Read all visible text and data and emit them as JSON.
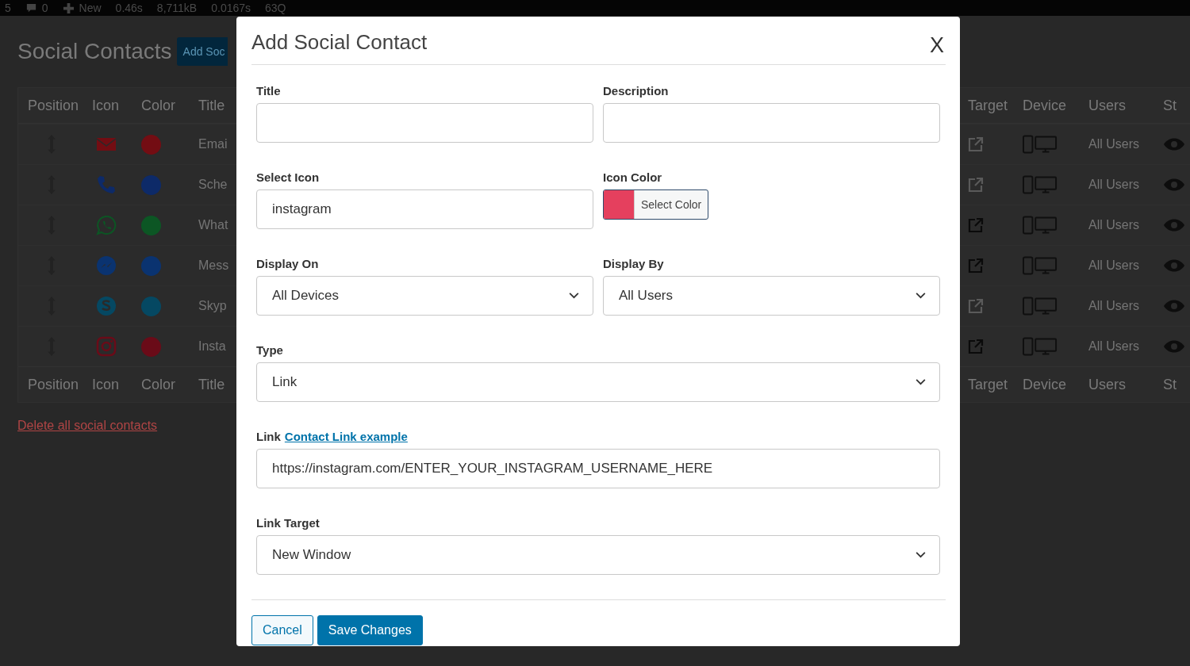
{
  "admin_bar": {
    "items": [
      {
        "kind": "text",
        "label": "5"
      },
      {
        "kind": "comments",
        "label": "0"
      },
      {
        "kind": "new",
        "label": "New"
      },
      {
        "kind": "text",
        "label": "0.46s"
      },
      {
        "kind": "text",
        "label": "8,711kB"
      },
      {
        "kind": "text",
        "label": "0.0167s"
      },
      {
        "kind": "text",
        "label": "63Q"
      }
    ]
  },
  "page": {
    "title": "Social Contacts",
    "add_button": "Add Soc"
  },
  "table": {
    "columns_left": [
      "Position",
      "Icon",
      "Color",
      "Title"
    ],
    "columns_right": [
      "Target",
      "Device",
      "Users",
      "St"
    ],
    "rows": [
      {
        "kind": "email",
        "color": "#730d13",
        "title": "Emai",
        "new_window": false,
        "users": "All Users"
      },
      {
        "kind": "phone",
        "color": "#0d2a68",
        "title": "Sche",
        "new_window": false,
        "users": "All Users"
      },
      {
        "kind": "whatsapp",
        "color": "#0c5624",
        "title": "What",
        "new_window": true,
        "users": "All Users"
      },
      {
        "kind": "messenger",
        "color": "#0a3370",
        "title": "Mess",
        "new_window": true,
        "users": "All Users"
      },
      {
        "kind": "skype",
        "color": "#054862",
        "title": "Skyp",
        "new_window": false,
        "users": "All Users"
      },
      {
        "kind": "instagram",
        "color": "#6a0b18",
        "title": "Insta",
        "new_window": true,
        "users": "All Users"
      }
    ],
    "footer_left": [
      "Position",
      "Icon",
      "Color",
      "Title"
    ],
    "footer_right": [
      "Target",
      "Device",
      "Users",
      "St"
    ]
  },
  "delete_link": "Delete all social contacts",
  "modal": {
    "title": "Add Social Contact",
    "close": "X",
    "fields": [
      {
        "kind": "text",
        "label": "Title",
        "full": false
      },
      {
        "kind": "text",
        "label": "Description",
        "full": false
      },
      {
        "kind": "text",
        "label": "Select Icon",
        "value": "instagram",
        "full": false
      },
      {
        "kind": "color",
        "label": "Icon Color",
        "color": "#e5405e",
        "button": "Select Color",
        "full": false
      },
      {
        "kind": "select",
        "label": "Display On",
        "value": "All Devices",
        "full": false
      },
      {
        "kind": "select",
        "label": "Display By",
        "value": "All Users",
        "full": false
      },
      {
        "kind": "select",
        "label": "Type",
        "value": "Link",
        "full": true
      },
      {
        "kind": "text",
        "label": "Link",
        "label_link": "Contact Link example",
        "value": "https://instagram.com/ENTER_YOUR_INSTAGRAM_USERNAME_HERE",
        "full": true
      },
      {
        "kind": "select",
        "label": "Link Target",
        "value": "New Window",
        "full": true
      }
    ],
    "buttons": [
      {
        "kind": "secondary",
        "label": "Cancel"
      },
      {
        "kind": "primary",
        "label": "Save Changes"
      }
    ]
  }
}
